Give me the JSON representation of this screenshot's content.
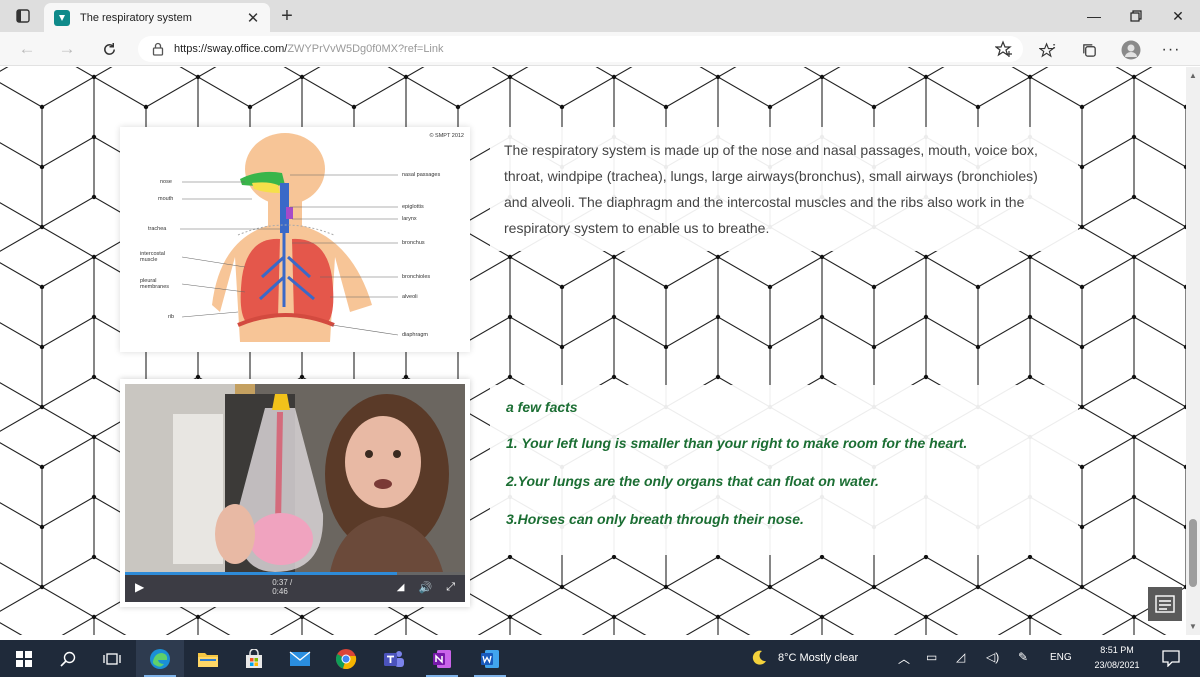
{
  "browser": {
    "tab_title": "The respiratory system",
    "url_host": "https://sway.office.com/",
    "url_path": "ZWYPrVvW5Dg0f0MX?ref=Link"
  },
  "diagram": {
    "copyright": "© SMPT 2012",
    "left_labels": [
      "nose",
      "mouth",
      "trachea",
      "intercostal muscle",
      "pleural membranes",
      "rib"
    ],
    "right_labels": [
      "nasal passages",
      "epiglottis",
      "larynx",
      "bronchus",
      "bronchioles",
      "alveoli",
      "diaphragm"
    ]
  },
  "content": {
    "intro": "The respiratory system is made up of the nose and nasal passages, mouth, voice box, throat, windpipe (trachea), lungs, large airways(bronchus), small airways (bronchioles) and alveoli. The diaphragm and the intercostal muscles and the ribs also work in the respiratory system to enable us to breathe.",
    "facts_heading": "a few facts",
    "facts": [
      "1. Your left lung is smaller than your right to make room for the heart.",
      "2.Your lungs are the only organs that can float on water.",
      "3.Horses can only breath through their nose."
    ]
  },
  "video": {
    "time": "0:37 / 0:46",
    "progress": 0.8
  },
  "taskbar": {
    "weather": "8°C  Mostly clear",
    "language": "ENG",
    "time": "8:51 PM",
    "date": "23/08/2021"
  },
  "colors": {
    "fact_green": "#1b6e33",
    "taskbar": "#1f2a3a",
    "tab_favicon": "#0f8a8a"
  }
}
